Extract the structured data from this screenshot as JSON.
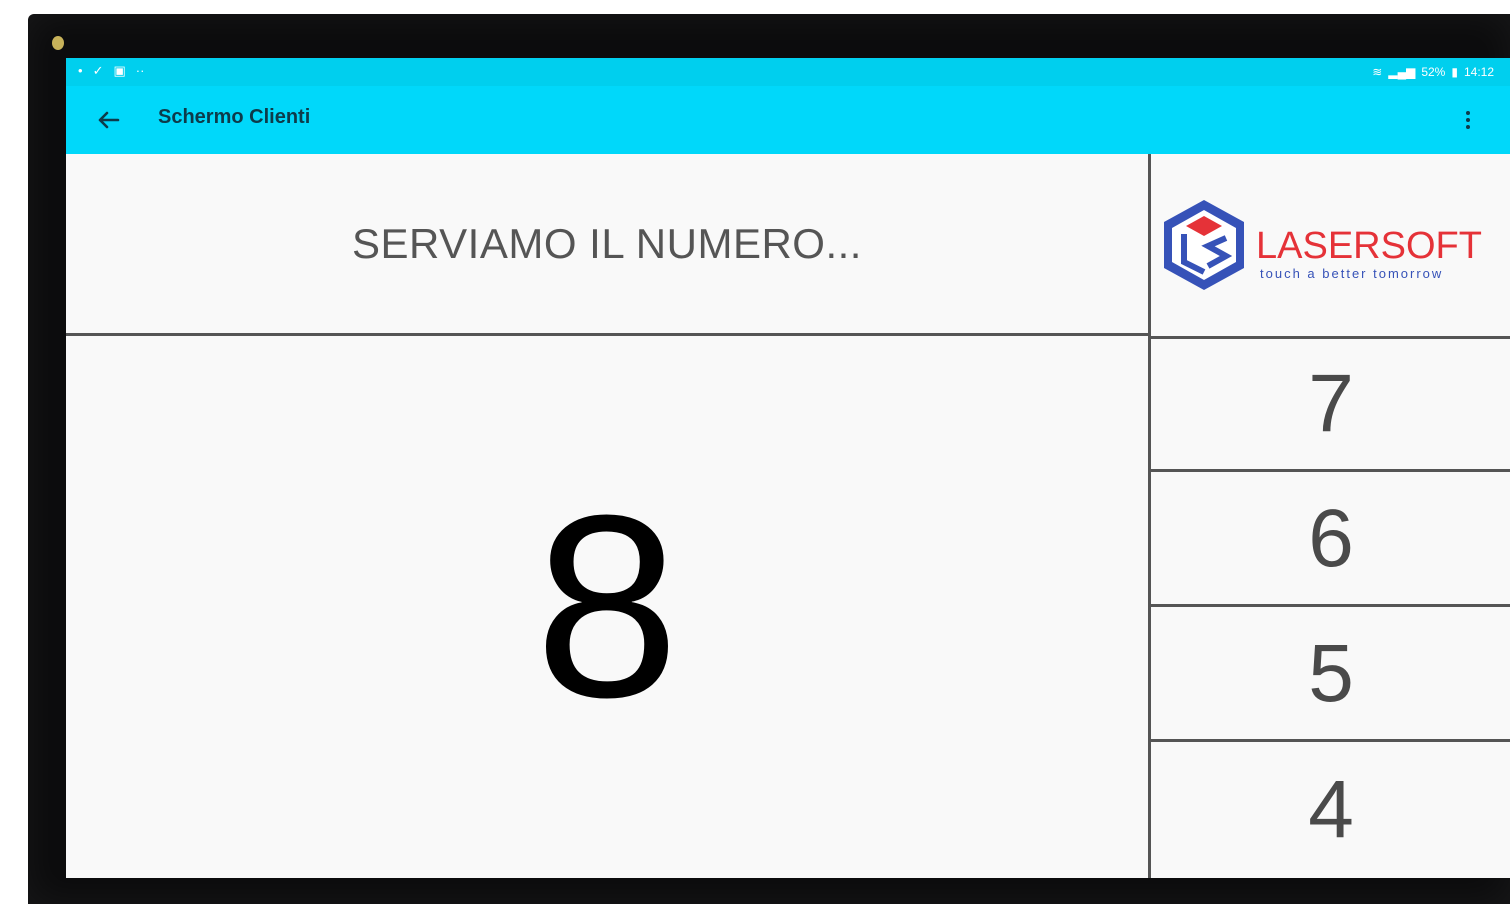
{
  "status_bar": {
    "left_icons": [
      "notification-dot-icon",
      "check-icon",
      "image-icon",
      "more-dots-icon"
    ],
    "right_text": "52% ▮ 14:12",
    "battery": "52%",
    "time": "14:12"
  },
  "app_bar": {
    "title": "Schermo Clienti",
    "background_color": "#00d8fa"
  },
  "header": {
    "label": "SERVIAMO IL NUMERO..."
  },
  "logo": {
    "name": "LASERSOFT",
    "tagline": "touch a better tomorrow",
    "brand_color": "#e53238",
    "icon_color": "#3652b8"
  },
  "current": {
    "number": "8"
  },
  "previous_numbers": [
    "7",
    "6",
    "5",
    "4"
  ]
}
